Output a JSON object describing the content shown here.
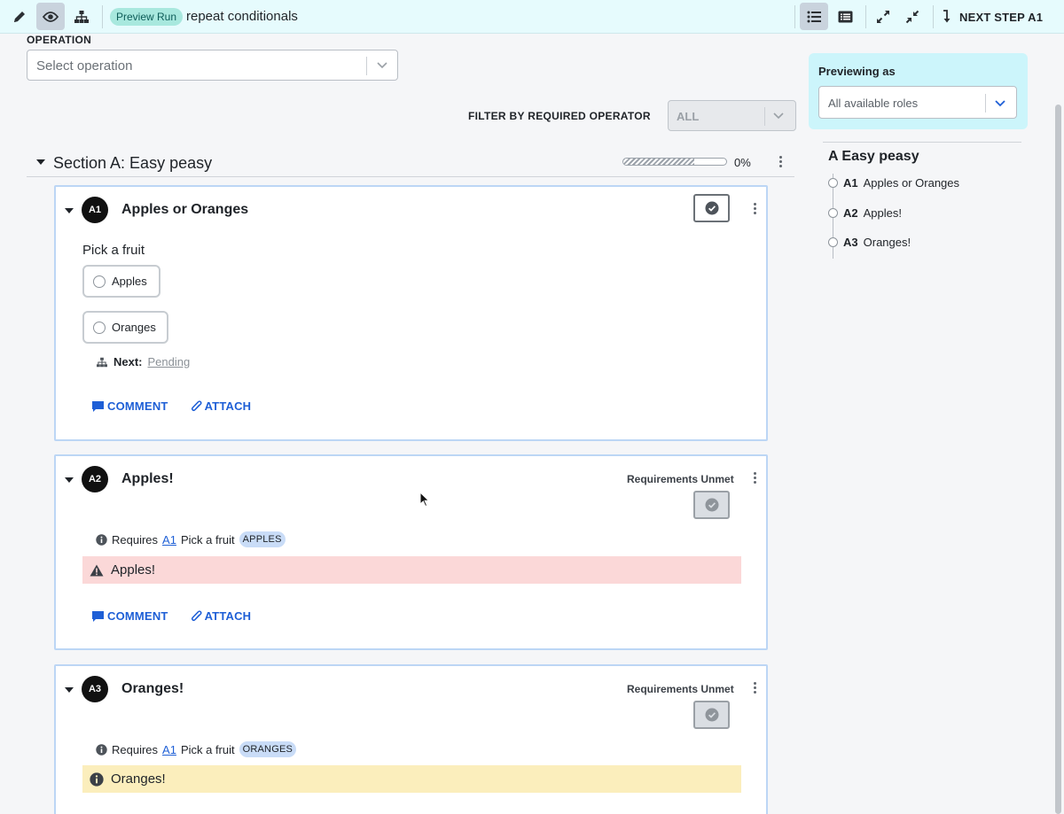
{
  "toolbar": {
    "tools": [
      {
        "icon": "pencil-icon"
      },
      {
        "icon": "eye-icon",
        "active": true
      },
      {
        "icon": "sitemap-icon"
      }
    ],
    "run_badge": "Preview Run",
    "run_title": "repeat conditionals",
    "view_buttons": [
      {
        "icon": "list-view-icon",
        "active": true
      },
      {
        "icon": "card-view-icon"
      },
      {
        "icon": "expand-icon"
      },
      {
        "icon": "collapse-icon"
      }
    ],
    "next_step_label": "NEXT STEP A1"
  },
  "operation": {
    "label": "OPERATION",
    "placeholder": "Select operation"
  },
  "filter": {
    "label": "FILTER BY REQUIRED OPERATOR",
    "value": "ALL"
  },
  "section": {
    "title": "Section A: Easy peasy",
    "progress_percent": 0,
    "progress_label": "0%"
  },
  "steps": [
    {
      "id": "A1",
      "title": "Apples or Oranges",
      "prompt": "Pick a fruit",
      "choices": [
        "Apples",
        "Oranges"
      ],
      "next_label": "Next:",
      "next_value": "Pending",
      "comment_label": "COMMENT",
      "attach_label": "ATTACH"
    },
    {
      "id": "A2",
      "title": "Apples!",
      "status": "Requirements Unmet",
      "requires_label": "Requires",
      "requires_step": "A1",
      "requires_field": "Pick a fruit",
      "requires_value": "APPLES",
      "alert_text": "Apples!",
      "alert_color": "#fbd8d8",
      "comment_label": "COMMENT",
      "attach_label": "ATTACH"
    },
    {
      "id": "A3",
      "title": "Oranges!",
      "status": "Requirements Unmet",
      "requires_label": "Requires",
      "requires_step": "A1",
      "requires_field": "Pick a fruit",
      "requires_value": "ORANGES",
      "alert_text": "Oranges!",
      "alert_color": "#fbeebc"
    }
  ],
  "preview": {
    "label": "Previewing as",
    "value": "All available roles"
  },
  "outline": {
    "title": "A Easy peasy",
    "items": [
      {
        "id": "A1",
        "label": "Apples or Oranges"
      },
      {
        "id": "A2",
        "label": "Apples!"
      },
      {
        "id": "A3",
        "label": "Oranges!"
      }
    ]
  },
  "colors": {
    "topbar_bg": "#e6fbfd",
    "accent_blue": "#1e5fd6",
    "badge_teal": "#a8e8de",
    "preview_panel": "#ccf5fb"
  }
}
